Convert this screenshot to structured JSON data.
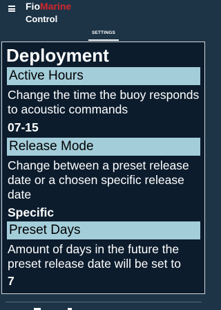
{
  "header": {
    "brand_part1": "Fio",
    "brand_part2": "Marine",
    "brand_sub": "Control",
    "menu_icon": "hamburger-menu-icon",
    "brand_accent_color": "#d0272c"
  },
  "tabs": [
    {
      "label": "SETTINGS",
      "active": true
    }
  ],
  "page": {
    "title": "Deployment",
    "sections": [
      {
        "header": "Active Hours",
        "description": "Change the time the buoy responds to acoustic commands",
        "value": "07-15"
      },
      {
        "header": "Release Mode",
        "description": "Change between a preset release date or a chosen specific release date",
        "value": "Specific"
      },
      {
        "header": "Preset Days",
        "description": "Amount of days in the future the preset release date will be set to",
        "value": "7"
      }
    ]
  },
  "colors": {
    "background": "#1d3447",
    "panel": "#0c1c2d",
    "section_header": "#a4cdda"
  }
}
